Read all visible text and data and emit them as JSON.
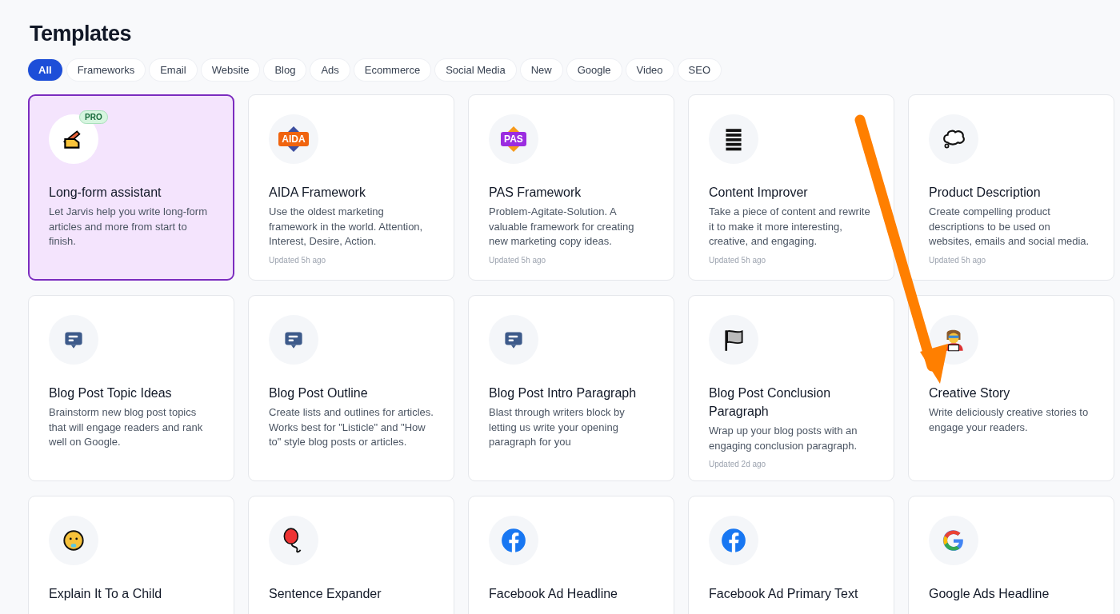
{
  "title": "Templates",
  "filters": [
    {
      "label": "All",
      "selected": true
    },
    {
      "label": "Frameworks",
      "selected": false
    },
    {
      "label": "Email",
      "selected": false
    },
    {
      "label": "Website",
      "selected": false
    },
    {
      "label": "Blog",
      "selected": false
    },
    {
      "label": "Ads",
      "selected": false
    },
    {
      "label": "Ecommerce",
      "selected": false
    },
    {
      "label": "Social Media",
      "selected": false
    },
    {
      "label": "New",
      "selected": false
    },
    {
      "label": "Google",
      "selected": false
    },
    {
      "label": "Video",
      "selected": false
    },
    {
      "label": "SEO",
      "selected": false
    }
  ],
  "templates": [
    {
      "title": "Long-form assistant",
      "description": "Let Jarvis help you write long-form articles and more from start to finish.",
      "badge": "PRO",
      "selected": true
    },
    {
      "title": "AIDA Framework",
      "icon_label": "AIDA",
      "description": "Use the oldest marketing framework in the world. Attention, Interest, Desire, Action.",
      "updated": "Updated 5h ago",
      "selected": false
    },
    {
      "title": "PAS Framework",
      "icon_label": "PAS",
      "description": "Problem-Agitate-Solution. A valuable framework for creating new marketing copy ideas.",
      "updated": "Updated 5h ago",
      "selected": false
    },
    {
      "title": "Content Improver",
      "description": "Take a piece of content and rewrite it to make it more interesting, creative, and engaging.",
      "updated": "Updated 5h ago",
      "selected": false
    },
    {
      "title": "Product Description",
      "description": "Create compelling product descriptions to be used on websites, emails and social media.",
      "updated": "Updated 5h ago",
      "selected": false
    },
    {
      "title": "Blog Post Topic Ideas",
      "description": "Brainstorm new blog post topics that will engage readers and rank well on Google.",
      "selected": false
    },
    {
      "title": "Blog Post Outline",
      "description": "Create lists and outlines for articles. Works best for \"Listicle\" and \"How to\" style blog posts or articles.",
      "selected": false
    },
    {
      "title": "Blog Post Intro Paragraph",
      "description": "Blast through writers block by letting us write your opening paragraph for you",
      "selected": false
    },
    {
      "title": "Blog Post Conclusion Paragraph",
      "description": "Wrap up your blog posts with an engaging conclusion paragraph.",
      "updated": "Updated 2d ago",
      "selected": false
    },
    {
      "title": "Creative Story",
      "description": "Write deliciously creative stories to engage your readers.",
      "selected": false
    },
    {
      "title": "Explain It To a Child",
      "selected": false
    },
    {
      "title": "Sentence Expander",
      "selected": false
    },
    {
      "title": "Facebook Ad Headline",
      "selected": false
    },
    {
      "title": "Facebook Ad Primary Text",
      "selected": false
    },
    {
      "title": "Google Ads Headline",
      "selected": false
    }
  ]
}
